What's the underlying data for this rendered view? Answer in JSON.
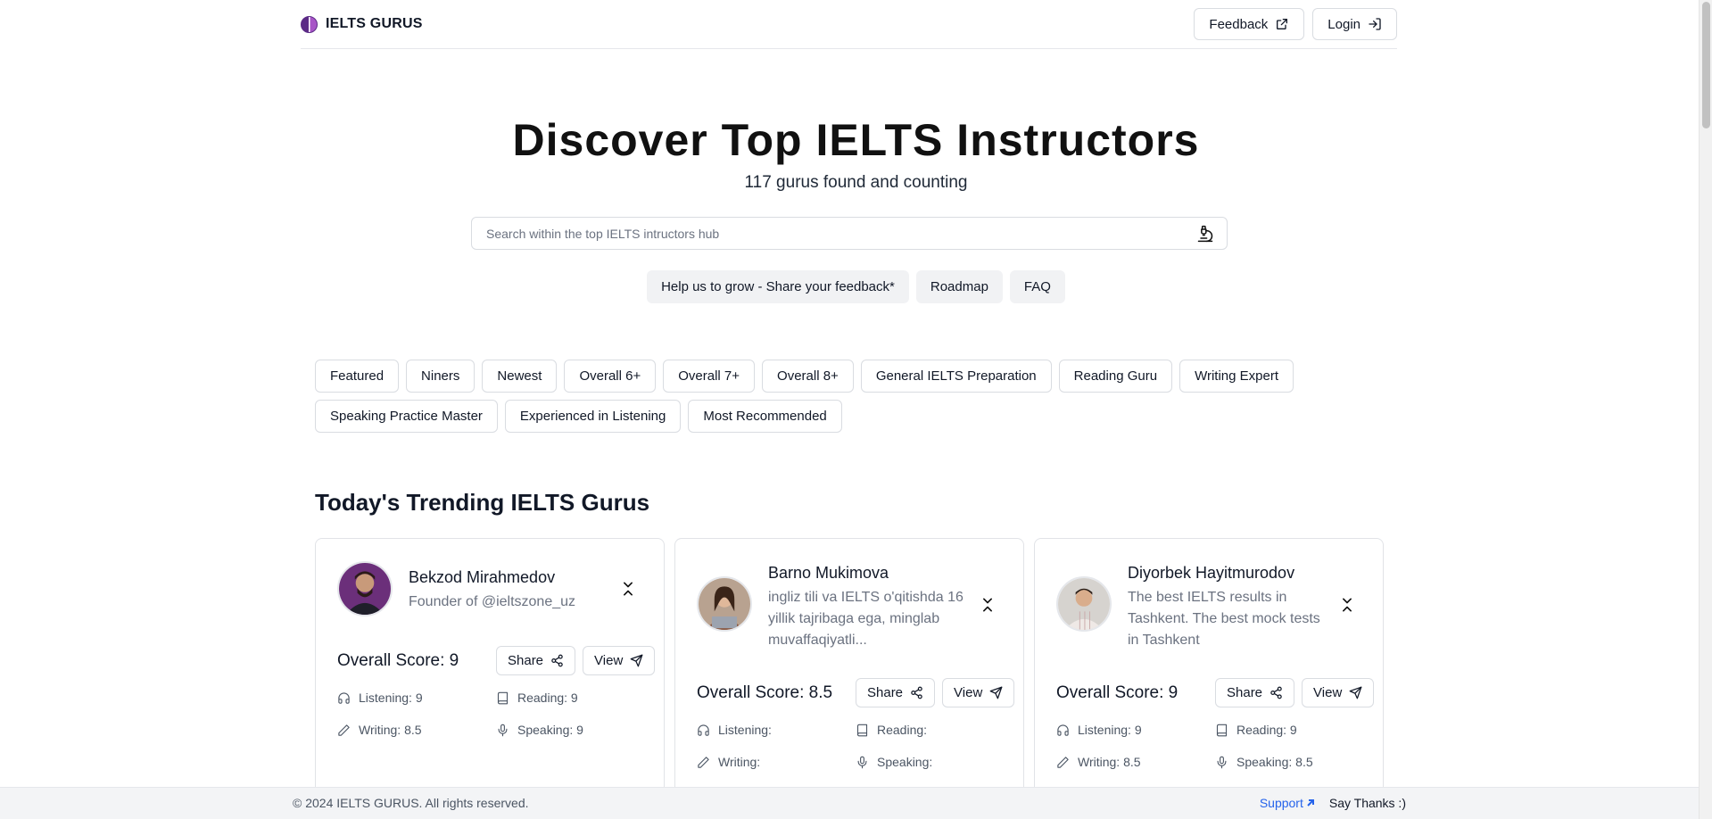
{
  "brand": {
    "name": "IELTS GURUS"
  },
  "header": {
    "feedback_label": "Feedback",
    "login_label": "Login"
  },
  "hero": {
    "title": "Discover Top IELTS Instructors",
    "subtitle": "117 gurus found and counting",
    "search_placeholder": "Search within the top IELTS intructors hub"
  },
  "quick_links": [
    {
      "label": "Help us to grow - Share your feedback*"
    },
    {
      "label": "Roadmap"
    },
    {
      "label": "FAQ"
    }
  ],
  "filters": [
    {
      "label": "Featured"
    },
    {
      "label": "Niners"
    },
    {
      "label": "Newest"
    },
    {
      "label": "Overall 6+"
    },
    {
      "label": "Overall 7+"
    },
    {
      "label": "Overall 8+"
    },
    {
      "label": "General IELTS Preparation"
    },
    {
      "label": "Reading Guru"
    },
    {
      "label": "Writing Expert"
    },
    {
      "label": "Speaking Practice Master"
    },
    {
      "label": "Experienced in Listening"
    },
    {
      "label": "Most Recommended"
    }
  ],
  "section_title": "Today's Trending IELTS Gurus",
  "cards": [
    {
      "name": "Bekzod Mirahmedov",
      "bio": "Founder of @ieltszone_uz",
      "overall": "Overall Score: 9",
      "share_label": "Share",
      "view_label": "View",
      "listening": "Listening: 9",
      "reading": "Reading: 9",
      "writing": "Writing: 8.5",
      "speaking": "Speaking: 9",
      "avatar_color": "#6b2f7a"
    },
    {
      "name": "Barno Mukimova",
      "bio": "ingliz tili va IELTS o'qitishda 16 yillik tajribaga ega, minglab muvaffaqiyatli...",
      "overall": "Overall Score: 8.5",
      "share_label": "Share",
      "view_label": "View",
      "listening": "Listening:",
      "reading": "Reading:",
      "writing": "Writing:",
      "speaking": "Speaking:",
      "avatar_color": "#8a5a44"
    },
    {
      "name": "Diyorbek Hayitmurodov",
      "bio": "The best IELTS results in Tashkent. The best mock tests in Tashkent",
      "overall": "Overall Score: 9",
      "share_label": "Share",
      "view_label": "View",
      "listening": "Listening: 9",
      "reading": "Reading: 9",
      "writing": "Writing: 8.5",
      "speaking": "Speaking: 8.5",
      "avatar_color": "#c9c4c0"
    }
  ],
  "footer": {
    "copyright": "© 2024 IELTS GURUS. All rights reserved.",
    "support_label": "Support",
    "thanks_label": "Say Thanks :)"
  }
}
